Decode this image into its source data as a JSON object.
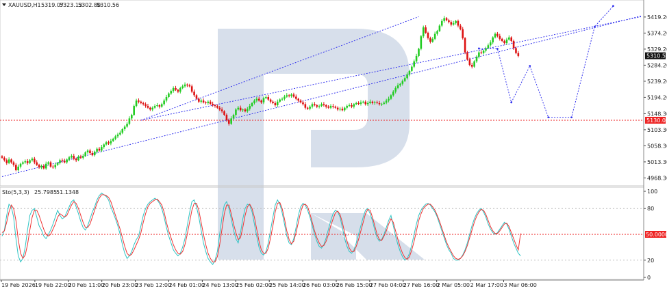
{
  "chart_data": [
    {
      "type": "candlestick",
      "symbol_header": {
        "symbol": "XAUUSD,H1",
        "open": "5319.07",
        "high": "5323.13",
        "low": "5302.80",
        "close": "5310.56"
      },
      "ylim": [
        4950,
        5440
      ],
      "y_ticks": [
        "5419.20",
        "5374.20",
        "5329.20",
        "5284.20",
        "5239.20",
        "5194.20",
        "5148.30",
        "5103.30",
        "5058.30",
        "5013.30",
        "4968.30"
      ],
      "current_price_label": "5310.56",
      "level_label": "5130.00",
      "level_value": 5130,
      "colors": {
        "bull": "#22cc22",
        "bear": "#dd1111",
        "trend": "#3333ee",
        "level": "#ee2222",
        "label_bg": "#ee2222",
        "current_bg": "#111111"
      },
      "closes": [
        5025,
        5018,
        5010,
        5020,
        5012,
        5005,
        4990,
        5000,
        5008,
        5012,
        5015,
        5010,
        5018,
        5022,
        5012,
        5005,
        4998,
        5002,
        4995,
        5008,
        5012,
        5000,
        4998,
        5005,
        5010,
        5018,
        5016,
        5012,
        5020,
        5026,
        5030,
        5022,
        5018,
        5028,
        5025,
        5030,
        5040,
        5045,
        5038,
        5032,
        5042,
        5050,
        5045,
        5055,
        5062,
        5068,
        5065,
        5072,
        5078,
        5085,
        5090,
        5095,
        5105,
        5112,
        5120,
        5135,
        5145,
        5170,
        5185,
        5182,
        5178,
        5175,
        5170,
        5165,
        5160,
        5165,
        5170,
        5172,
        5168,
        5175,
        5185,
        5195,
        5205,
        5212,
        5220,
        5215,
        5210,
        5220,
        5225,
        5230,
        5228,
        5225,
        5210,
        5200,
        5190,
        5182,
        5185,
        5180,
        5178,
        5182,
        5176,
        5172,
        5170,
        5165,
        5160,
        5155,
        5145,
        5130,
        5120,
        5135,
        5145,
        5160,
        5165,
        5158,
        5160,
        5155,
        5162,
        5170,
        5178,
        5185,
        5190,
        5185,
        5180,
        5192,
        5195,
        5188,
        5182,
        5178,
        5172,
        5182,
        5188,
        5190,
        5196,
        5200,
        5198,
        5202,
        5196,
        5190,
        5185,
        5180,
        5175,
        5165,
        5162,
        5168,
        5175,
        5172,
        5168,
        5170,
        5175,
        5172,
        5168,
        5165,
        5170,
        5168,
        5165,
        5160,
        5162,
        5158,
        5165,
        5170,
        5172,
        5168,
        5175,
        5178,
        5176,
        5180,
        5182,
        5175,
        5178,
        5182,
        5178,
        5180,
        5178,
        5175,
        5176,
        5179,
        5185,
        5190,
        5200,
        5210,
        5220,
        5228,
        5232,
        5240,
        5248,
        5258,
        5268,
        5280,
        5295,
        5310,
        5330,
        5365,
        5390,
        5375,
        5360,
        5350,
        5358,
        5372,
        5380,
        5395,
        5408,
        5416,
        5410,
        5405,
        5398,
        5402,
        5408,
        5395,
        5385,
        5360,
        5320,
        5300,
        5285,
        5280,
        5295,
        5308,
        5320,
        5318,
        5325,
        5332,
        5340,
        5348,
        5362,
        5372,
        5366,
        5358,
        5352,
        5346,
        5356,
        5362,
        5352,
        5332,
        5318,
        5310
      ],
      "projection": {
        "start": 206,
        "points": [
          [
            206,
            5331
          ],
          [
            214,
            5330
          ],
          [
            220,
            5180
          ],
          [
            228,
            5282
          ],
          [
            236,
            5138
          ],
          [
            246,
            5138
          ],
          [
            256,
            5392
          ],
          [
            264,
            5450
          ]
        ]
      },
      "trendlines": [
        {
          "from": [
            0,
            4972
          ],
          "to": [
            276,
            5422
          ]
        },
        {
          "from": [
            60,
            5130
          ],
          "to": [
            180,
            5420
          ]
        },
        {
          "from": [
            60,
            5130
          ],
          "to": [
            276,
            5420
          ]
        }
      ]
    },
    {
      "type": "line",
      "name": "stochastic",
      "header": {
        "label": "Sto(5,3,3)",
        "v1": "25.7985",
        "v2": "51.1348"
      },
      "ylim": [
        0,
        100
      ],
      "y_ticks": [
        "100",
        "80",
        "20",
        "0"
      ],
      "level_label": "50.0000",
      "level_value": 50,
      "guide_levels": [
        80,
        20
      ],
      "colors": {
        "main": "#2ec4c4",
        "signal": "#ee3333",
        "level": "#ee2222"
      },
      "main": [
        48,
        55,
        72,
        85,
        82,
        70,
        45,
        25,
        18,
        22,
        35,
        55,
        72,
        78,
        80,
        70,
        60,
        55,
        48,
        45,
        50,
        55,
        62,
        70,
        78,
        72,
        68,
        70,
        76,
        82,
        88,
        90,
        82,
        74,
        65,
        58,
        55,
        60,
        68,
        76,
        82,
        90,
        95,
        98,
        96,
        94,
        90,
        82,
        75,
        68,
        60,
        50,
        38,
        28,
        22,
        25,
        30,
        38,
        44,
        48,
        60,
        72,
        80,
        85,
        88,
        90,
        92,
        90,
        86,
        80,
        70,
        58,
        48,
        40,
        32,
        28,
        25,
        28,
        35,
        45,
        60,
        75,
        88,
        90,
        82,
        70,
        55,
        40,
        30,
        22,
        18,
        15,
        20,
        30,
        50,
        70,
        84,
        88,
        80,
        68,
        55,
        45,
        40,
        52,
        68,
        80,
        85,
        84,
        76,
        62,
        48,
        35,
        28,
        26,
        30,
        40,
        55,
        70,
        84,
        90,
        85,
        75,
        62,
        48,
        40,
        38,
        45,
        58,
        72,
        82,
        86,
        84,
        78,
        70,
        60,
        50,
        42,
        36,
        34,
        38,
        46,
        56,
        66,
        74,
        78,
        76,
        70,
        58,
        45,
        36,
        30,
        28,
        32,
        40,
        50,
        60,
        70,
        78,
        80,
        74,
        66,
        55,
        46,
        42,
        44,
        50,
        58,
        66,
        72,
        60,
        48,
        38,
        30,
        24,
        20,
        22,
        28,
        38,
        50,
        62,
        72,
        78,
        82,
        85,
        86,
        84,
        80,
        76,
        70,
        62,
        54,
        46,
        38,
        32,
        28,
        22,
        20,
        20,
        22,
        26,
        32,
        40,
        50,
        60,
        68,
        74,
        78,
        80,
        76,
        70,
        62,
        56,
        52,
        50,
        52,
        56,
        60,
        64,
        62,
        56,
        48,
        40,
        34,
        28,
        25
      ],
      "signal": [
        52,
        54,
        64,
        76,
        84,
        80,
        66,
        44,
        28,
        22,
        26,
        38,
        55,
        70,
        78,
        78,
        72,
        64,
        56,
        50,
        48,
        50,
        56,
        62,
        70,
        74,
        72,
        70,
        72,
        78,
        84,
        88,
        86,
        80,
        72,
        64,
        58,
        58,
        62,
        70,
        78,
        86,
        92,
        96,
        96,
        95,
        93,
        88,
        80,
        72,
        64,
        56,
        46,
        36,
        28,
        25,
        27,
        32,
        38,
        44,
        52,
        64,
        74,
        82,
        86,
        88,
        90,
        91,
        88,
        84,
        76,
        64,
        54,
        46,
        38,
        32,
        28,
        27,
        30,
        38,
        50,
        64,
        78,
        86,
        86,
        78,
        64,
        50,
        38,
        28,
        22,
        18,
        18,
        24,
        38,
        56,
        74,
        84,
        84,
        74,
        62,
        52,
        44,
        46,
        58,
        72,
        82,
        85,
        80,
        70,
        56,
        42,
        32,
        28,
        28,
        34,
        46,
        60,
        76,
        86,
        87,
        80,
        68,
        54,
        44,
        39,
        42,
        52,
        64,
        76,
        84,
        85,
        82,
        74,
        64,
        54,
        46,
        40,
        36,
        37,
        42,
        50,
        60,
        68,
        75,
        77,
        73,
        64,
        52,
        42,
        34,
        30,
        30,
        36,
        44,
        54,
        64,
        74,
        79,
        78,
        70,
        60,
        50,
        44,
        43,
        48,
        54,
        62,
        68,
        64,
        54,
        44,
        35,
        28,
        23,
        21,
        24,
        32,
        42,
        54,
        66,
        74,
        80,
        83,
        85,
        85,
        82,
        78,
        72,
        65,
        57,
        49,
        41,
        35,
        30,
        25,
        22,
        21,
        22,
        25,
        30,
        37,
        46,
        55,
        64,
        71,
        76,
        79,
        78,
        73,
        66,
        59,
        54,
        51,
        51,
        54,
        58,
        62,
        63,
        59,
        52,
        45,
        38,
        32,
        51
      ]
    },
    {
      "type": "axis",
      "x_tick_labels": [
        "19 Feb 2026",
        "19 Feb 22:00",
        "20 Feb 11:00",
        "20 Feb 23:00",
        "23 Feb 12:00",
        "24 Feb 01:00",
        "24 Feb 13:00",
        "25 Feb 02:00",
        "25 Feb 14:00",
        "26 Feb 03:00",
        "26 Feb 15:00",
        "27 Feb 04:00",
        "27 Feb 16:00",
        "2 Mar 05:00",
        "2 Mar 17:00",
        "3 Mar 06:00"
      ]
    }
  ]
}
